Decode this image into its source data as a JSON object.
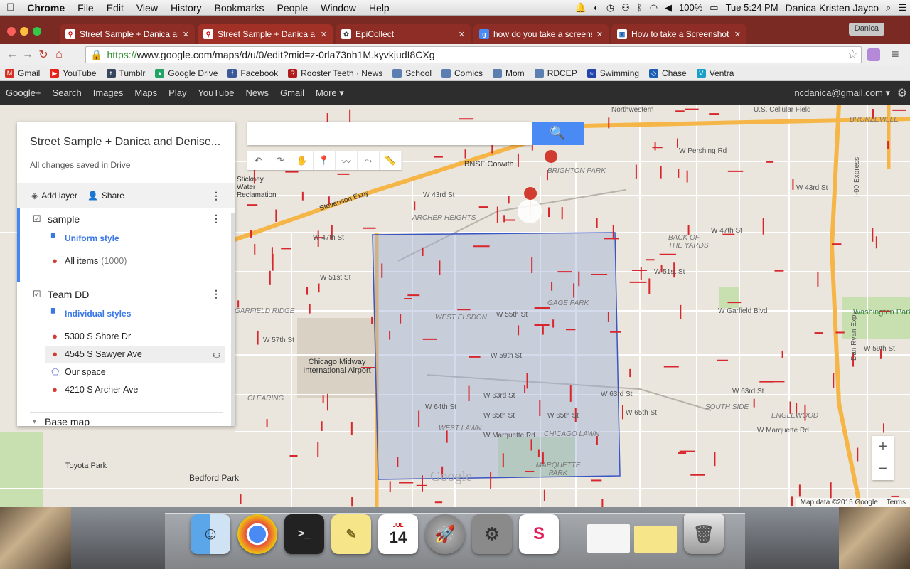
{
  "menubar": {
    "apple": "",
    "app": "Chrome",
    "items": [
      "File",
      "Edit",
      "View",
      "History",
      "Bookmarks",
      "People",
      "Window",
      "Help"
    ],
    "battery": "100%",
    "clock": "Tue 5:24 PM",
    "user": "Danica Kristen Jayco"
  },
  "tabs": [
    {
      "label": "Street Sample + Danica an"
    },
    {
      "label": "Street Sample + Danica a"
    },
    {
      "label": "EpiCollect"
    },
    {
      "label": "how do you take a screens"
    },
    {
      "label": "How to take a Screenshot"
    }
  ],
  "profile": "Danica",
  "address": {
    "scheme": "https://",
    "rest": "www.google.com/maps/d/u/0/edit?mid=z-0rla73nh1M.kyvkjudI8CXg"
  },
  "bookmarks": [
    {
      "label": "Gmail",
      "color": "#d93025"
    },
    {
      "label": "YouTube",
      "color": "#e62117"
    },
    {
      "label": "Tumblr",
      "color": "#36465d"
    },
    {
      "label": "Google Drive",
      "color": "#1fa463"
    },
    {
      "label": "Facebook",
      "color": "#3b5998"
    },
    {
      "label": "Rooster Teeth · News",
      "color": "#b01c1c"
    },
    {
      "label": "School",
      "color": "#5a7fb0"
    },
    {
      "label": "Comics",
      "color": "#5a7fb0"
    },
    {
      "label": "Mom",
      "color": "#5a7fb0"
    },
    {
      "label": "RDCEP",
      "color": "#5a7fb0"
    },
    {
      "label": "Swimming",
      "color": "#2244aa"
    },
    {
      "label": "Chase",
      "color": "#1a5fb4"
    },
    {
      "label": "Ventra",
      "color": "#1aa0c8"
    }
  ],
  "gbar": {
    "links": [
      "Google+",
      "Search",
      "Images",
      "Maps",
      "Play",
      "YouTube",
      "News",
      "Gmail",
      "More ▾"
    ],
    "account": "ncdanica@gmail.com ▾"
  },
  "panel": {
    "title": "Street Sample + Danica and Denise...",
    "subtitle": "All changes saved in Drive",
    "add_layer": "Add layer",
    "share": "Share",
    "layers": [
      {
        "name": "sample",
        "style": "Uniform style",
        "items": [
          {
            "label": "All items",
            "count": "(1000)"
          }
        ]
      },
      {
        "name": "Team DD",
        "style": "Individual styles",
        "items": [
          {
            "label": "5300 S Shore Dr"
          },
          {
            "label": "4545 S Sawyer Ave"
          },
          {
            "label": "Our space"
          },
          {
            "label": "4210 S Archer Ave"
          }
        ]
      }
    ],
    "base_map": "Base map"
  },
  "map": {
    "labels": {
      "northwestern": "Northwestern",
      "us_cellular": "U.S. Cellular Field",
      "pershing": "W Pershing Rd",
      "w43": "W 43rd St",
      "w47": "W 47th St",
      "w51": "W 51st St",
      "w55": "W 55th St",
      "w57": "W 57th St",
      "w59": "W 59th St",
      "w63": "W 63rd St",
      "w64": "W 64th St",
      "w65": "W 65th St",
      "marquette": "W Marquette Rd",
      "garfield": "W Garfield Blvd",
      "archer_heights": "ARCHER HEIGHTS",
      "brighton": "BRIGHTON PARK",
      "back_yards": "BACK OF THE YARDS",
      "gage": "GAGE PARK",
      "west_elsdon": "WEST ELSDON",
      "west_lawn": "WEST LAWN",
      "chicago_lawn": "CHICAGO LAWN",
      "marquette_park": "MARQUETTE PARK",
      "midway": "Chicago Midway International Airport",
      "garfield_ridge": "GARFIELD RIDGE",
      "clearing": "CLEARING",
      "south_side": "SOUTH SIDE",
      "englewood": "ENGLEWOOD",
      "washington_park": "Washington Park",
      "toyota": "Toyota Park",
      "bedford": "Bedford Park",
      "bnsf": "BNSF Corwith",
      "stevenson": "Stevenson Expy",
      "sw_water": "Stickney Water Reclamation",
      "bronzeville": "BRONZEVILLE",
      "ryan": "Dan Ryan Expy",
      "i90": "I-90 Express"
    },
    "zoom_in": "+",
    "zoom_out": "−",
    "attribution": "Map data ©2015 Google",
    "terms": "Terms",
    "watermark": "Google"
  },
  "search": {
    "button": "🔍"
  },
  "tools": [
    "↶",
    "↷",
    "✋",
    "📍",
    "〰",
    "⤳",
    "📏"
  ],
  "dock": {
    "icons": [
      "Finder",
      "Chrome",
      "Terminal",
      "Notes",
      "Calendar",
      "Launchpad",
      "System Preferences",
      "Slack"
    ],
    "calendar_day": "14",
    "calendar_month": "JUL"
  }
}
